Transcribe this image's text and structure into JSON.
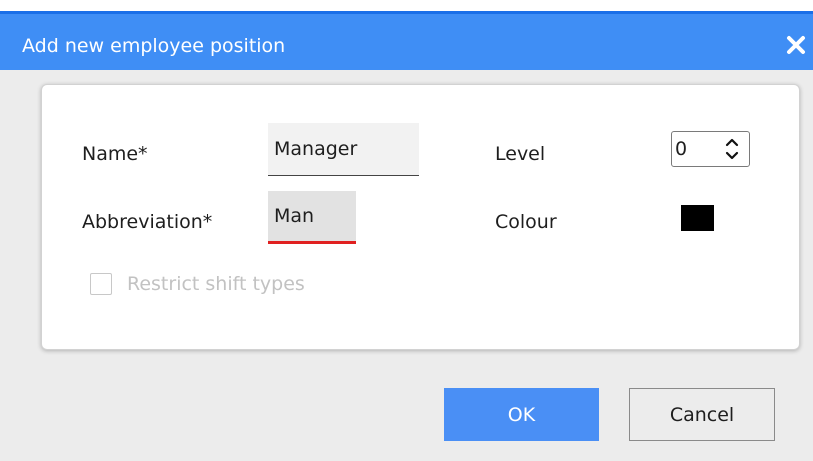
{
  "dialog": {
    "title": "Add new employee position",
    "close_icon": "close-x-icon"
  },
  "form": {
    "name_label": "Name*",
    "name_value": "Manager",
    "abbreviation_label": "Abbreviation*",
    "abbreviation_value": "Man",
    "level_label": "Level",
    "level_value": "0",
    "colour_label": "Colour",
    "colour_value": "#000000",
    "restrict_label": "Restrict shift types",
    "restrict_checked": false
  },
  "buttons": {
    "ok_label": "OK",
    "cancel_label": "Cancel"
  },
  "colors": {
    "titlebar": "#3f8ef5",
    "ok_button": "#4a8ff5",
    "error_underline": "#e02020"
  }
}
